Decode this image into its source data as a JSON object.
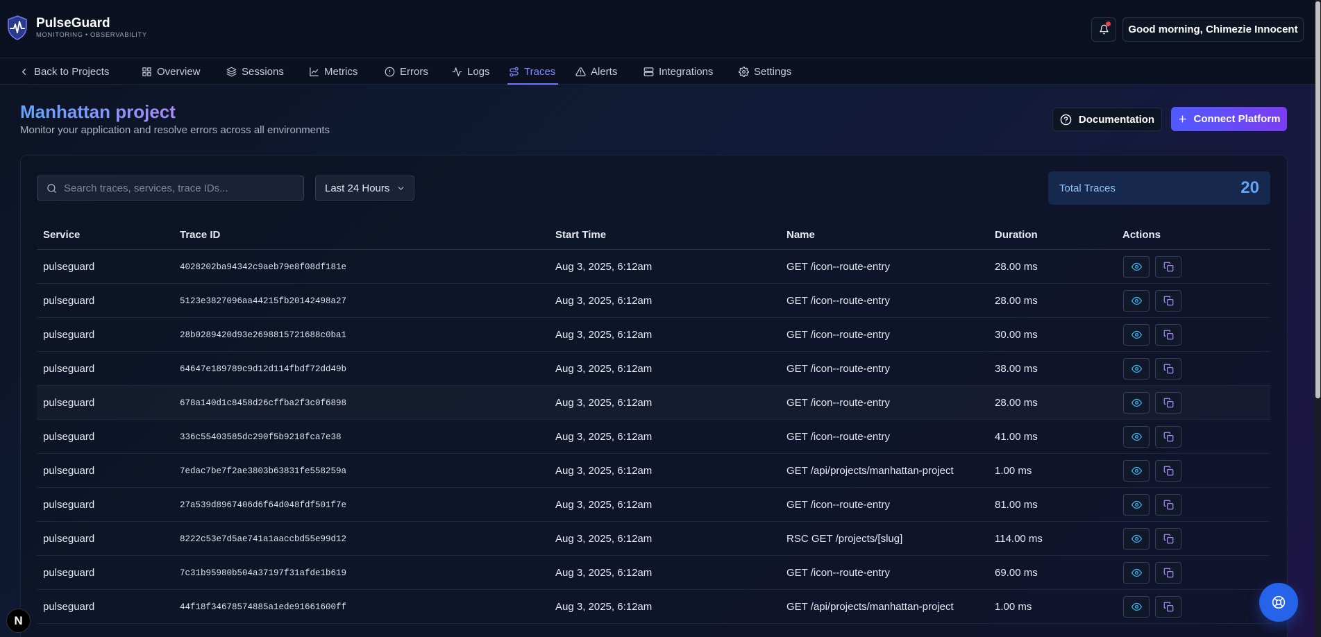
{
  "brand": {
    "name": "PulseGuard",
    "tagline": "MONITORING • OBSERVABILITY"
  },
  "header": {
    "greeting": "Good morning, Chimezie Innocent",
    "bell_icon": "bell-icon",
    "has_notification": true
  },
  "nav": {
    "back_label": "Back to Projects",
    "items": [
      {
        "label": "Overview",
        "icon": "grid-icon"
      },
      {
        "label": "Sessions",
        "icon": "layers-icon"
      },
      {
        "label": "Metrics",
        "icon": "chart-line-icon"
      },
      {
        "label": "Errors",
        "icon": "alert-circle-icon"
      },
      {
        "label": "Logs",
        "icon": "activity-icon"
      },
      {
        "label": "Traces",
        "icon": "route-icon",
        "active": true
      },
      {
        "label": "Alerts",
        "icon": "alert-triangle-icon"
      },
      {
        "label": "Integrations",
        "icon": "server-icon"
      },
      {
        "label": "Settings",
        "icon": "gear-icon"
      }
    ]
  },
  "page": {
    "title": "Manhattan project",
    "subtitle": "Monitor your application and resolve errors across all environments",
    "doc_button": "Documentation",
    "connect_button": "Connect Platform"
  },
  "filters": {
    "search_placeholder": "Search traces, services, trace IDs...",
    "search_value": "",
    "time_range": "Last 24 Hours"
  },
  "stats": {
    "total_label": "Total Traces",
    "total_value": "20"
  },
  "table": {
    "headers": [
      "Service",
      "Trace ID",
      "Start Time",
      "Name",
      "Duration",
      "Actions"
    ],
    "rows": [
      {
        "service": "pulseguard",
        "trace_id": "4028202ba94342c9aeb79e8f08df181e",
        "start": "Aug 3, 2025, 6:12am",
        "name": "GET /icon--route-entry",
        "duration": "28.00 ms"
      },
      {
        "service": "pulseguard",
        "trace_id": "5123e3827096aa44215fb20142498a27",
        "start": "Aug 3, 2025, 6:12am",
        "name": "GET /icon--route-entry",
        "duration": "28.00 ms"
      },
      {
        "service": "pulseguard",
        "trace_id": "28b0289420d93e2698815721688c0ba1",
        "start": "Aug 3, 2025, 6:12am",
        "name": "GET /icon--route-entry",
        "duration": "30.00 ms"
      },
      {
        "service": "pulseguard",
        "trace_id": "64647e189789c9d12d114fbdf72dd49b",
        "start": "Aug 3, 2025, 6:12am",
        "name": "GET /icon--route-entry",
        "duration": "38.00 ms"
      },
      {
        "service": "pulseguard",
        "trace_id": "678a140d1c8458d26cffba2f3c0f6898",
        "start": "Aug 3, 2025, 6:12am",
        "name": "GET /icon--route-entry",
        "duration": "28.00 ms"
      },
      {
        "service": "pulseguard",
        "trace_id": "336c55403585dc290f5b9218fca7e38",
        "start": "Aug 3, 2025, 6:12am",
        "name": "GET /icon--route-entry",
        "duration": "41.00 ms"
      },
      {
        "service": "pulseguard",
        "trace_id": "7edac7be7f2ae3803b63831fe558259a",
        "start": "Aug 3, 2025, 6:12am",
        "name": "GET /api/projects/manhattan-project",
        "duration": "1.00 ms"
      },
      {
        "service": "pulseguard",
        "trace_id": "27a539d8967406d6f64d048fdf501f7e",
        "start": "Aug 3, 2025, 6:12am",
        "name": "GET /icon--route-entry",
        "duration": "81.00 ms"
      },
      {
        "service": "pulseguard",
        "trace_id": "8222c53e7d5ae741a1aaccbd55e99d12",
        "start": "Aug 3, 2025, 6:12am",
        "name": "RSC GET /projects/[slug]",
        "duration": "114.00 ms"
      },
      {
        "service": "pulseguard",
        "trace_id": "7c31b95980b504a37197f31afde1b619",
        "start": "Aug 3, 2025, 6:12am",
        "name": "GET /icon--route-entry",
        "duration": "69.00 ms"
      },
      {
        "service": "pulseguard",
        "trace_id": "44f18f34678574885a1ede91661600ff",
        "start": "Aug 3, 2025, 6:12am",
        "name": "GET /api/projects/manhattan-project",
        "duration": "1.00 ms"
      }
    ]
  },
  "floating": {
    "help_icon": "lifebuoy-icon",
    "framework_badge": "N"
  }
}
